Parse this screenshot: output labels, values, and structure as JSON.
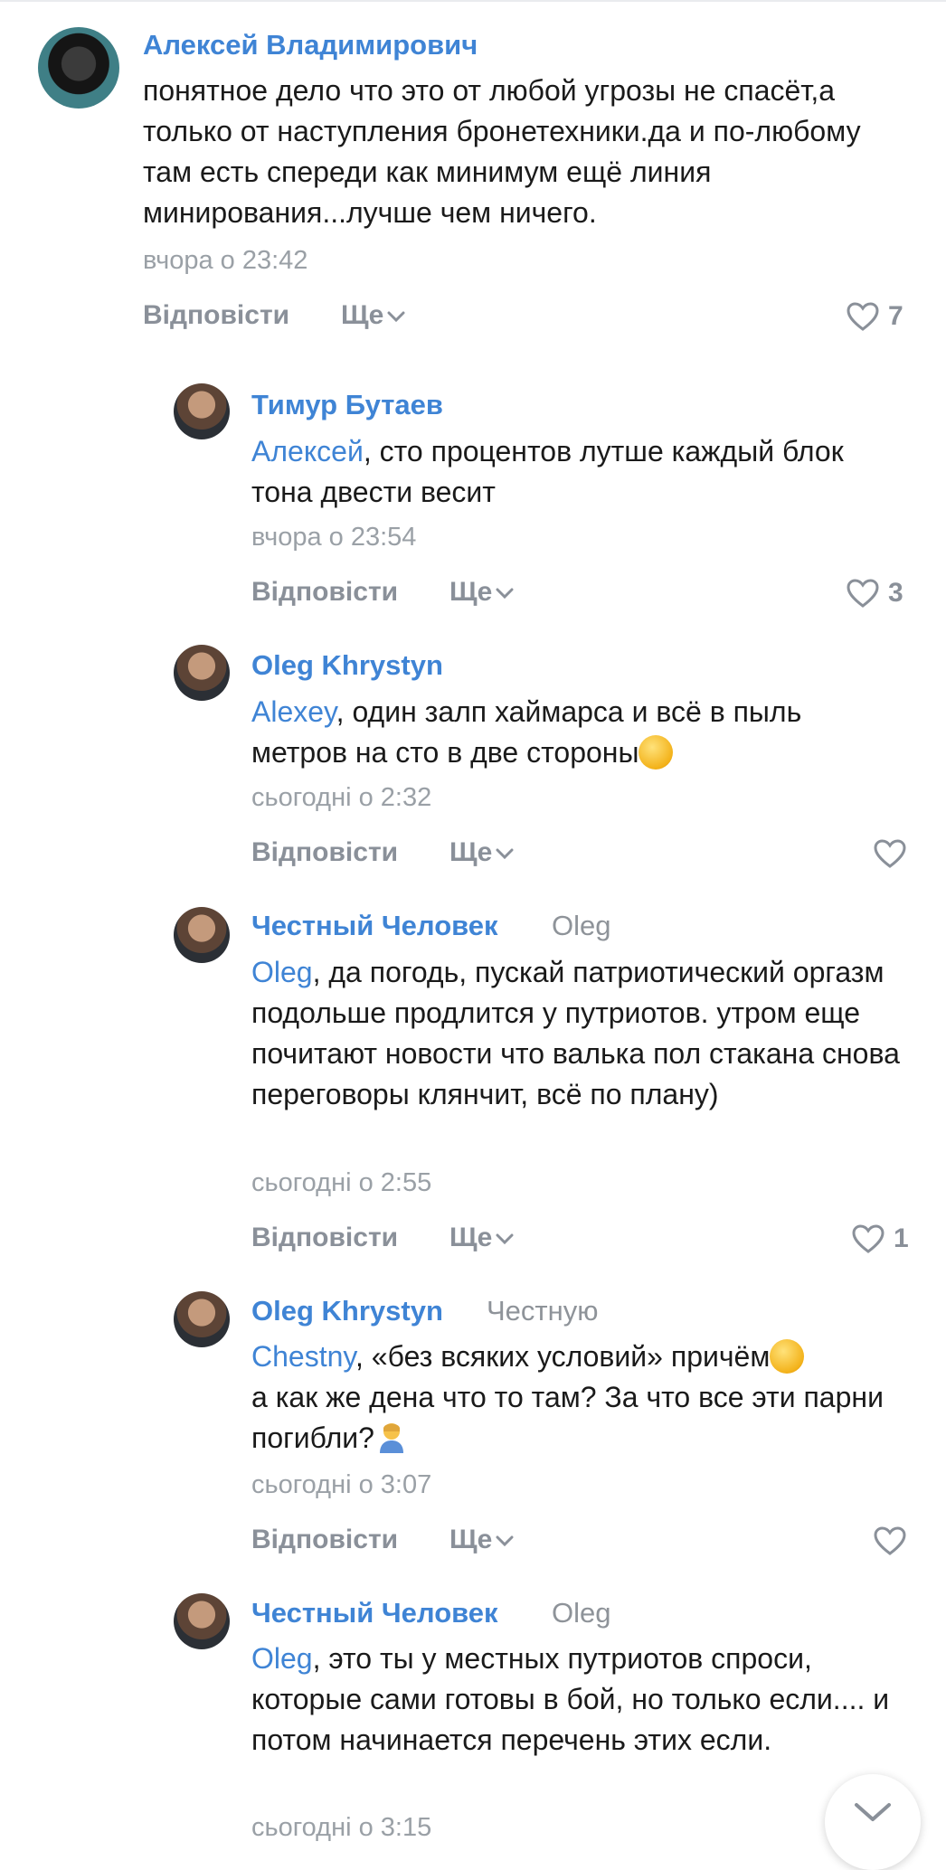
{
  "comments": [
    {
      "author": "Алексей Владимирович",
      "reply_to": "",
      "mention": "",
      "text": "понятное дело что это от любой угрозы не спасёт,а только от наступления бронетехники.да и по-любому там есть спереди как минимум ещё линия минирования...лучше чем ничего.",
      "time": "вчора о 23:42",
      "reply_label": "Відповісти",
      "more_label": "Ще",
      "likes": "7"
    },
    {
      "author": "Тимур Бутаев",
      "reply_to": "",
      "mention": "Алексей",
      "text": ", сто процентов лутше каждый блок тона двести весит",
      "time": "вчора о 23:54",
      "reply_label": "Відповісти",
      "more_label": "Ще",
      "likes": "3"
    },
    {
      "author": "Oleg Khrystyn",
      "reply_to": "",
      "mention": "Alexey",
      "text": ", один залп хаймарса и всё в пыль метров на сто в две стороны",
      "emoji": "grinning-squinting-face",
      "time": "сьогодні о 2:32",
      "reply_label": "Відповісти",
      "more_label": "Ще",
      "likes": ""
    },
    {
      "author": "Честный Человек",
      "reply_to": "Oleg",
      "mention": "Oleg",
      "text": ", да погодь, пускай патриотический оргазм подольше продлится у путриотов. утром еще почитают новости что валька пол стакана снова переговоры клянчит, всё по плану)",
      "time": "сьогодні о 2:55",
      "reply_label": "Відповісти",
      "more_label": "Ще",
      "likes": "1"
    },
    {
      "author": "Oleg Khrystyn",
      "reply_to": "Честную",
      "mention": "Chestny",
      "text_a": ", «без всяких условий» причём",
      "text_b": "а как же дена что то там? За что все эти парни погибли?",
      "time": "сьогодні о 3:07",
      "reply_label": "Відповісти",
      "more_label": "Ще",
      "likes": ""
    },
    {
      "author": "Честный Человек",
      "reply_to": "Oleg",
      "mention": "Oleg",
      "text": ", это ты у местных путриотов спроси, которые сами готовы в бой, но только если.... и потом начинается перечень этих если.",
      "time": "сьогодні о 3:15"
    }
  ],
  "icons": {
    "like": "heart-outline-icon",
    "more": "chevron-down-icon",
    "scroll": "chevron-down-icon"
  },
  "colors": {
    "name": "#3f84d5",
    "meta": "#8a9099",
    "text": "#1a1a1a"
  }
}
